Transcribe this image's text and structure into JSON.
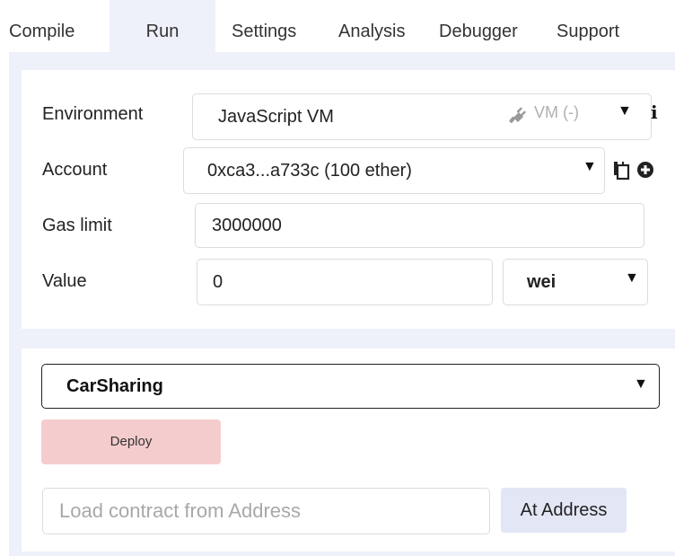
{
  "tabs": [
    {
      "label": "Compile",
      "active": false
    },
    {
      "label": "Run",
      "active": true
    },
    {
      "label": "Settings",
      "active": false
    },
    {
      "label": "Analysis",
      "active": false
    },
    {
      "label": "Debugger",
      "active": false
    },
    {
      "label": "Support",
      "active": false
    }
  ],
  "environment": {
    "label": "Environment",
    "value": "JavaScript VM",
    "tag": "VM (-)",
    "arrow": "▼",
    "info_glyph": "i"
  },
  "account": {
    "label": "Account",
    "value": "0xca3...a733c (100 ether)",
    "arrow": "▼"
  },
  "gas_limit": {
    "label": "Gas limit",
    "value": "3000000"
  },
  "value": {
    "label": "Value",
    "amount": "0",
    "unit": "wei",
    "arrow": "▼"
  },
  "contract": {
    "selected": "CarSharing",
    "arrow": "▼",
    "deploy_label": "Deploy"
  },
  "address": {
    "placeholder": "Load contract from Address",
    "button_label": "At Address"
  },
  "colors": {
    "panel_bg": "#eef0fa",
    "deploy_bg": "#f5cccd",
    "at_address_bg": "#e3e6f5"
  },
  "icons": {
    "environment": "plug-icon",
    "info": "info-icon",
    "copy": "copy-icon",
    "add": "plus-circle-icon"
  }
}
